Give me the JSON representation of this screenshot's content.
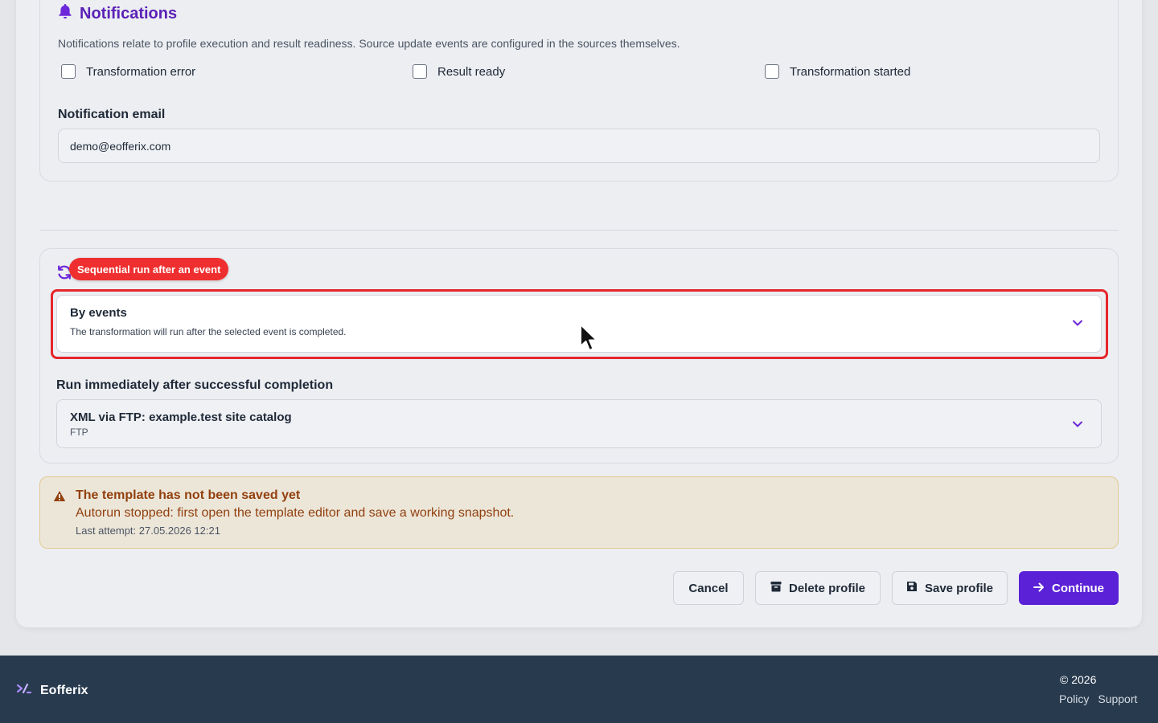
{
  "notifications": {
    "title": "Notifications",
    "description": "Notifications relate to profile execution and result readiness. Source update events are configured in the sources themselves.",
    "checkboxes": [
      {
        "label": "Transformation error",
        "checked": false
      },
      {
        "label": "Result ready",
        "checked": false
      },
      {
        "label": "Transformation started",
        "checked": false
      }
    ],
    "email_label": "Notification email",
    "email_value": "demo@eofferix.com"
  },
  "run": {
    "tooltip": "Sequential run after an event",
    "trigger_select": {
      "title": "By events",
      "subtitle": "The transformation will run after the selected event is completed."
    },
    "after_label": "Run immediately after successful completion",
    "source_select": {
      "title": "XML via FTP: example.test site catalog",
      "subtitle": "FTP"
    }
  },
  "warning": {
    "title": "The template has not been saved yet",
    "text": "Autorun stopped: first open the template editor and save a working snapshot.",
    "meta": "Last attempt: 27.05.2026 12:21"
  },
  "actions": {
    "cancel": "Cancel",
    "delete": "Delete profile",
    "save": "Save profile",
    "continue": "Continue"
  },
  "footer": {
    "brand": "Eofferix",
    "copyright": "© 2026",
    "links": [
      "Policy",
      "Support"
    ]
  },
  "colors": {
    "accent": "#5b21d6",
    "highlight": "#e5262b",
    "warning_text": "#92400e",
    "footer_bg": "#283a4e"
  }
}
